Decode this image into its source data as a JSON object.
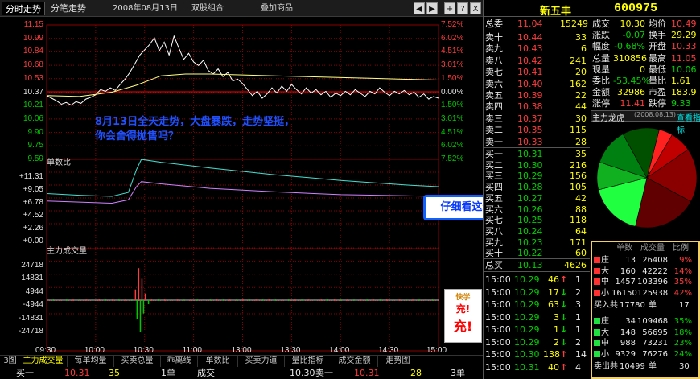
{
  "toolbar": {
    "tabs": [
      "分时走势",
      "分笔走势"
    ],
    "date_field": "2008年08月13日",
    "mode_field": "双股组合",
    "overlay_field": "叠加商品",
    "buttons": [
      "◀",
      "▶",
      "+",
      "?",
      "X"
    ]
  },
  "price_axis": {
    "left": [
      "11.15",
      "10.99",
      "10.84",
      "10.68",
      "10.53",
      "10.37",
      "10.21",
      "10.06",
      "9.90",
      "9.75",
      "9.59"
    ],
    "right": [
      "7.52%",
      "6.02%",
      "4.51%",
      "3.01%",
      "1.50%",
      "0.00%",
      "1.50%",
      "3.01%",
      "4.51%",
      "6.02%",
      "7.52%"
    ]
  },
  "panel_titles": {
    "ratio": "单数比",
    "volume": "主力成交量"
  },
  "ratio_axis": [
    "+11.31",
    "+9.05",
    "+6.78",
    "+4.52",
    "+2.26",
    "+0.00"
  ],
  "volume_axis": [
    "24718",
    "14831",
    "4944",
    "-4944",
    "-14831",
    "-24718"
  ],
  "time_axis": [
    "09:30",
    "10:00",
    "10:30",
    "11:00",
    "13:00",
    "13:30",
    "14:00",
    "14:30",
    "15:00"
  ],
  "annotation": {
    "line1": "8月13日全天走势，大盘暴跌，走势坚挺，",
    "line2": "你会舍得抛售吗？"
  },
  "callout": "仔细看这个区域，同上图",
  "ad_badge": {
    "top": "快学",
    "l1": "充!",
    "l2": "充!"
  },
  "bottom_tabs": [
    "3图",
    "主力成交量",
    "每单均量",
    "买卖总量",
    "乖离线",
    "单数比",
    "买卖力道",
    "量比指标",
    "成交金额",
    "走势图"
  ],
  "bottom_quote": {
    "label": "买一",
    "price": "10.31",
    "vol": "35",
    "unit": "1单",
    "label2": "成交",
    "price2": "10.30",
    "label3": "卖一",
    "price3": "10.31",
    "vol3": "28",
    "unit3": "3单"
  },
  "stock": {
    "name": "新五丰",
    "code": "600975"
  },
  "committee": {
    "label": "总委",
    "value": "11.04",
    "vol": "15249"
  },
  "sell_levels": [
    {
      "label": "卖十",
      "price": "10.44",
      "vol": "33"
    },
    {
      "label": "卖九",
      "price": "10.43",
      "vol": "6"
    },
    {
      "label": "卖八",
      "price": "10.42",
      "vol": "241"
    },
    {
      "label": "卖七",
      "price": "10.41",
      "vol": "20"
    },
    {
      "label": "卖六",
      "price": "10.40",
      "vol": "162"
    },
    {
      "label": "卖五",
      "price": "10.39",
      "vol": "22"
    },
    {
      "label": "卖四",
      "price": "10.38",
      "vol": "44"
    },
    {
      "label": "卖三",
      "price": "10.37",
      "vol": "30"
    },
    {
      "label": "卖二",
      "price": "10.35",
      "vol": "115"
    },
    {
      "label": "卖一",
      "price": "10.33",
      "vol": "28"
    }
  ],
  "buy_levels": [
    {
      "label": "买一",
      "price": "10.31",
      "vol": "35"
    },
    {
      "label": "买二",
      "price": "10.30",
      "vol": "216"
    },
    {
      "label": "买三",
      "price": "10.29",
      "vol": "156"
    },
    {
      "label": "买四",
      "price": "10.28",
      "vol": "105"
    },
    {
      "label": "买五",
      "price": "10.27",
      "vol": "42"
    },
    {
      "label": "买六",
      "price": "10.26",
      "vol": "88"
    },
    {
      "label": "买七",
      "price": "10.25",
      "vol": "118"
    },
    {
      "label": "买八",
      "price": "10.24",
      "vol": "64"
    },
    {
      "label": "买九",
      "price": "10.23",
      "vol": "171"
    },
    {
      "label": "买十",
      "price": "10.22",
      "vol": "60"
    }
  ],
  "total_buy": {
    "label": "总买",
    "price": "10.13",
    "vol": "4626"
  },
  "quote": {
    "rows": [
      {
        "l1": "成交",
        "v1": "10.30",
        "l2": "均价",
        "v2": "10.49"
      },
      {
        "l1": "涨跌",
        "v1": "-0.07",
        "l2": "换手",
        "v2": "29.29"
      },
      {
        "l1": "幅度",
        "v1": "-0.68%",
        "l2": "开盘",
        "v2": "10.33"
      },
      {
        "l1": "总量",
        "v1": "310856",
        "l2": "最高",
        "v2": "11.05"
      },
      {
        "l1": "现量",
        "v1": "0",
        "l2": "最低",
        "v2": "10.06"
      },
      {
        "l1": "委比",
        "v1": "-53.45%",
        "l2": "量比",
        "v2": "1.61"
      },
      {
        "l1": "金额",
        "v1": "32986",
        "l2": "市盈",
        "v2": "183.9"
      },
      {
        "l1": "涨停",
        "v1": "11.41",
        "l2": "跌停",
        "v2": "9.33"
      }
    ]
  },
  "dragon": {
    "title": "主力龙虎",
    "date": "(2008.08.13)",
    "link": "查看指标"
  },
  "pie": {
    "slices": [
      {
        "name": "庄买",
        "value": 9,
        "color": "#ff2020"
      },
      {
        "name": "大买",
        "value": 14,
        "color": "#c00000"
      },
      {
        "name": "中买",
        "value": 35,
        "color": "#8a0000"
      },
      {
        "name": "小买",
        "value": 42,
        "color": "#600000"
      },
      {
        "name": "庄卖",
        "value": 35,
        "color": "#20ff40"
      },
      {
        "name": "大卖",
        "value": 18,
        "color": "#10b020"
      },
      {
        "name": "中卖",
        "value": 24,
        "color": "#008010"
      },
      {
        "name": "小卖",
        "value": 24,
        "color": "#005000"
      }
    ]
  },
  "dragon_table": {
    "headers": [
      "单数",
      "成交量",
      "比例"
    ],
    "buy_rows": [
      {
        "name": "庄",
        "count": "13",
        "vol": "26408",
        "pct": "9%"
      },
      {
        "name": "大",
        "count": "160",
        "vol": "42222",
        "pct": "14%"
      },
      {
        "name": "中",
        "count": "1457",
        "vol": "103396",
        "pct": "35%"
      },
      {
        "name": "小",
        "count": "16150",
        "vol": "125938",
        "pct": "42%"
      }
    ],
    "buy_total": {
      "label": "买入共",
      "count": "17780",
      "unit": "单",
      "extra": "17"
    },
    "sell_rows": [
      {
        "name": "庄",
        "count": "34",
        "vol": "109468",
        "pct": "35%"
      },
      {
        "name": "大",
        "count": "148",
        "vol": "56695",
        "pct": "18%"
      },
      {
        "name": "中",
        "count": "988",
        "vol": "73231",
        "pct": "23%"
      },
      {
        "name": "小",
        "count": "9329",
        "vol": "76276",
        "pct": "24%"
      }
    ],
    "sell_total": {
      "label": "卖出共",
      "count": "10499",
      "unit": "单",
      "extra": "30"
    }
  },
  "ticks": [
    {
      "time": "15:00",
      "price": "10.29",
      "vol": "46",
      "dir": "up",
      "n": "1"
    },
    {
      "time": "15:00",
      "price": "10.29",
      "vol": "17",
      "dir": "down",
      "n": "2"
    },
    {
      "time": "15:00",
      "price": "10.29",
      "vol": "63",
      "dir": "down",
      "n": "3"
    },
    {
      "time": "15:00",
      "price": "10.29",
      "vol": "3",
      "dir": "down",
      "n": "1"
    },
    {
      "time": "15:00",
      "price": "10.29",
      "vol": "1",
      "dir": "down",
      "n": "1"
    },
    {
      "time": "15:00",
      "price": "10.29",
      "vol": "2",
      "dir": "down",
      "n": "2"
    },
    {
      "time": "15:00",
      "price": "10.30",
      "vol": "138",
      "dir": "up",
      "n": "14"
    },
    {
      "time": "15:00",
      "price": "10.31",
      "vol": "40",
      "dir": "up",
      "n": "4"
    }
  ],
  "colors": {
    "up": "#ff3c3c",
    "down": "#00c800",
    "price_line": "#ffffff",
    "avg_line": "#ffff80",
    "grid": "#8b0000"
  }
}
